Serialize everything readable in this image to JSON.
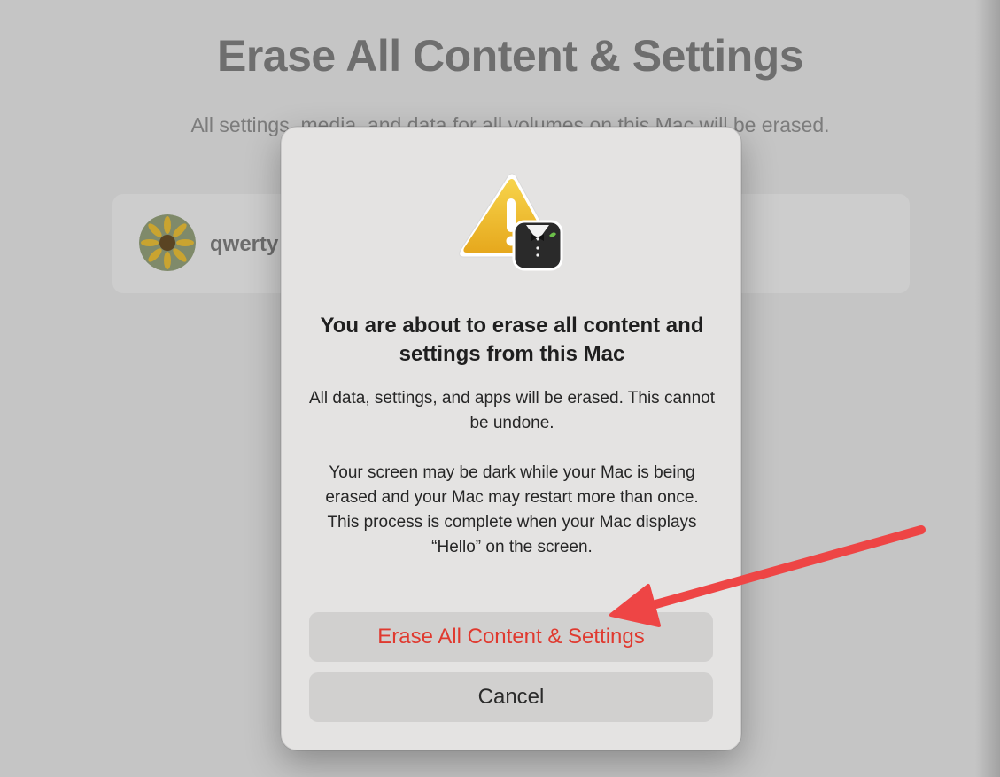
{
  "background": {
    "title": "Erase All Content & Settings",
    "subtitle": "All settings, media, and data for all volumes on this Mac will be erased.",
    "user": {
      "name": "qwerty",
      "avatar_icon": "sunflower-avatar-icon"
    }
  },
  "dialog": {
    "icon": "warning-tuxedo-icon",
    "heading": "You are about to erase all content and settings from this Mac",
    "body_paragraph_1": "All data, settings, and apps will be erased. This cannot be undone.",
    "body_paragraph_2": "Your screen may be dark while your Mac is being erased and your Mac may restart more than once. This process is complete when your Mac displays “Hello” on the screen.",
    "buttons": {
      "erase_label": "Erase All Content & Settings",
      "cancel_label": "Cancel"
    }
  },
  "colors": {
    "destructive": "#e0392f",
    "annotation_arrow": "#ee4545",
    "warning_yellow": "#f2c12e"
  }
}
